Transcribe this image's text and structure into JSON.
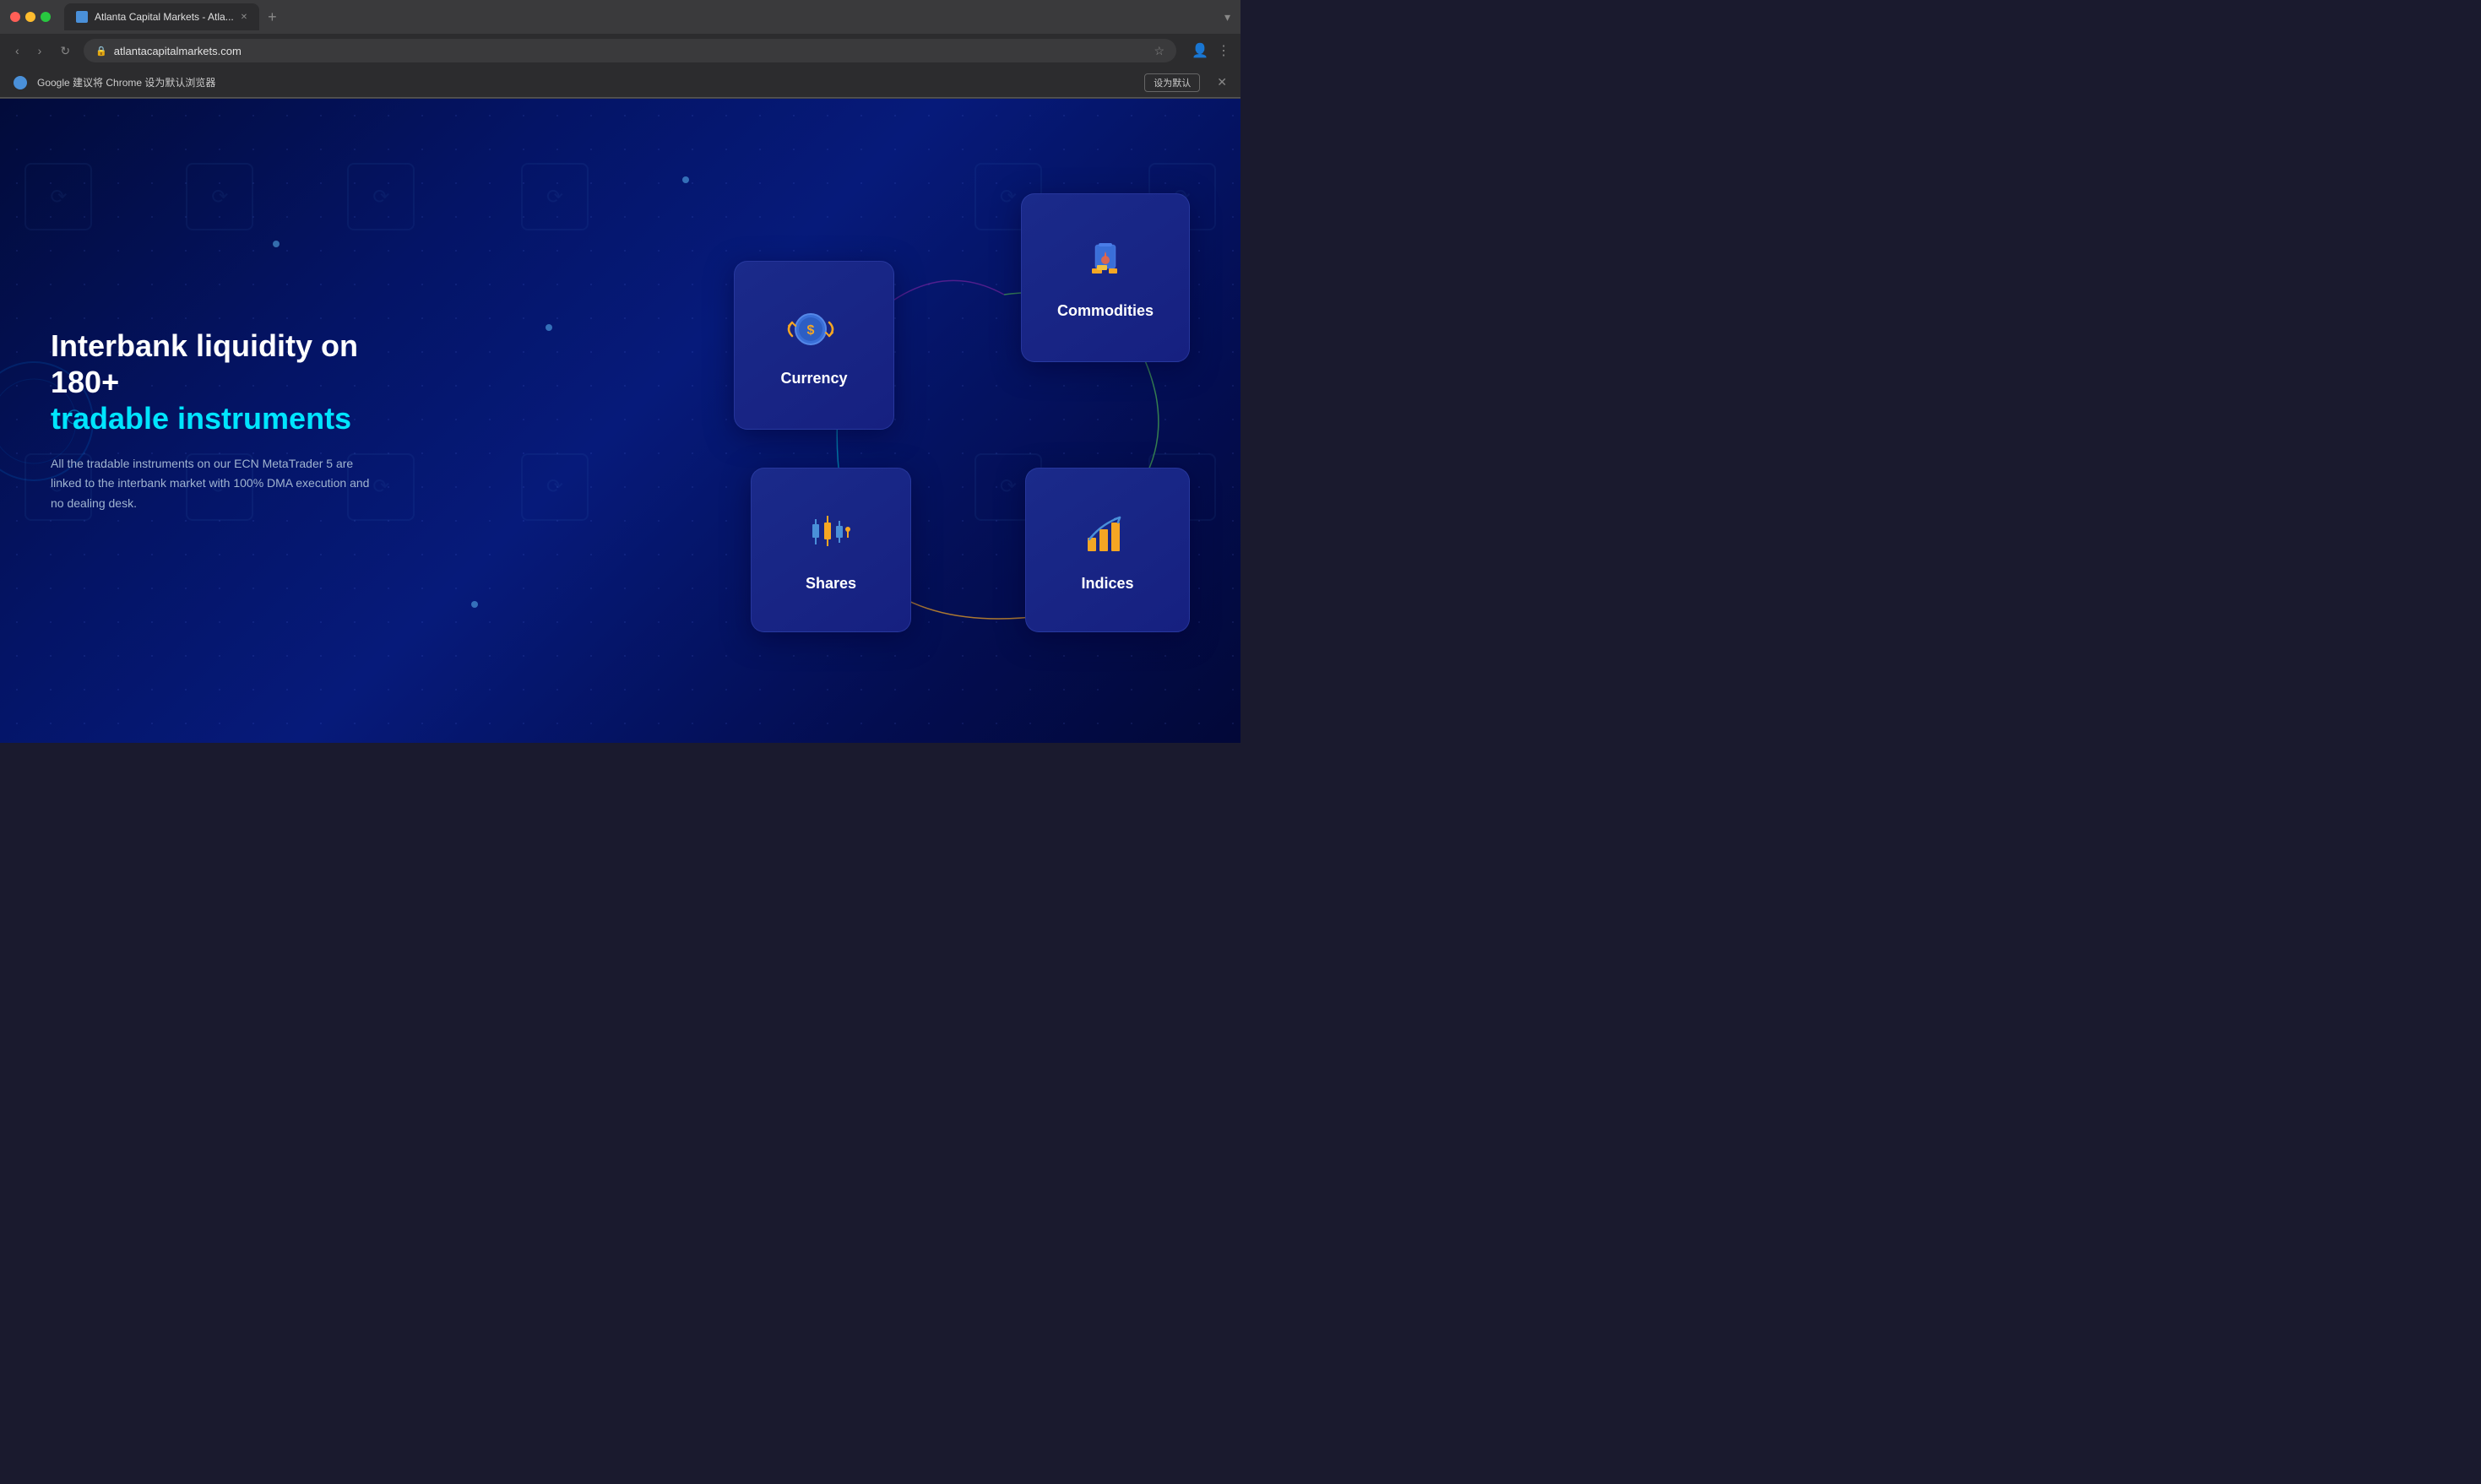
{
  "browser": {
    "tab_title": "Atlanta Capital Markets - Atla...",
    "tab_favicon": "A",
    "url": "atlantacapitalmarkets.com",
    "new_tab_label": "+",
    "dropdown_label": "▾"
  },
  "notification": {
    "text": "Google 建议将 Chrome 设为默认浏览器",
    "action_label": "设为默认",
    "close_label": "✕"
  },
  "hero": {
    "title_line1": "Interbank liquidity on 180+",
    "title_line2": "tradable instruments",
    "description": "All the tradable instruments on our ECN MetaTrader 5 are linked to the interbank market with 100% DMA execution and no dealing desk."
  },
  "instruments": {
    "commodities": {
      "label": "Commodities"
    },
    "currency": {
      "label": "Currency"
    },
    "indices": {
      "label": "Indices"
    },
    "shares": {
      "label": "Shares"
    }
  },
  "colors": {
    "accent_cyan": "#00e5ff",
    "card_bg": "#1a2a8a",
    "icon_orange": "#f5a623",
    "icon_blue": "#4a90d9"
  }
}
